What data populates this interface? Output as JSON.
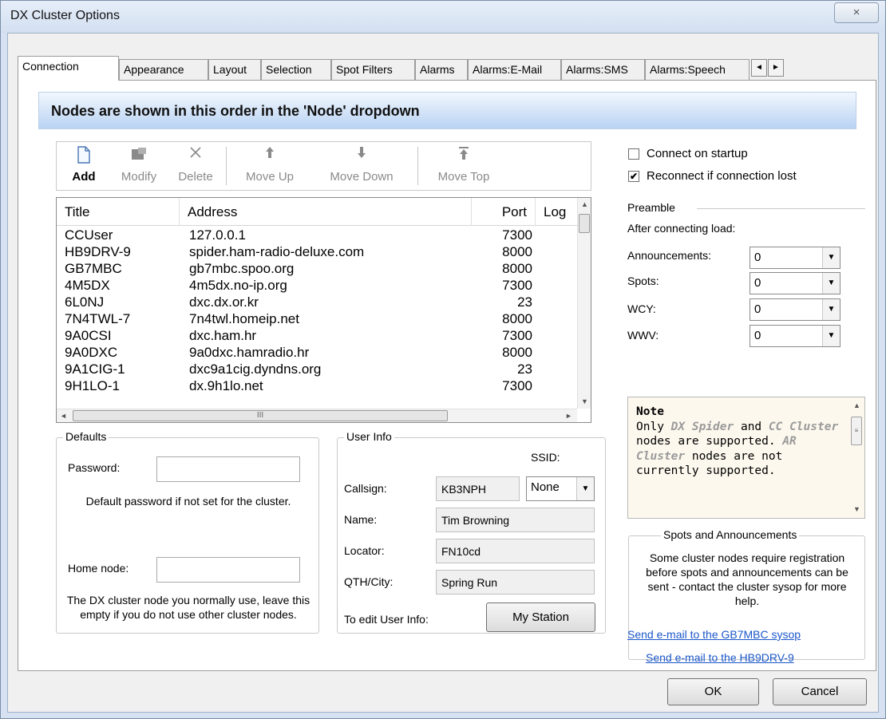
{
  "window": {
    "title": "DX Cluster Options",
    "close_icon": "×"
  },
  "tabs": [
    "Connection",
    "Appearance",
    "Layout",
    "Selection",
    "Spot Filters",
    "Alarms",
    "Alarms:E-Mail",
    "Alarms:SMS",
    "Alarms:Speech"
  ],
  "banner": "Nodes are shown in this order in the 'Node' dropdown",
  "toolbar": {
    "add": "Add",
    "modify": "Modify",
    "delete": "Delete",
    "move_up": "Move Up",
    "move_down": "Move Down",
    "move_top": "Move Top"
  },
  "list": {
    "columns": {
      "title": "Title",
      "address": "Address",
      "port": "Port",
      "log": "Log"
    },
    "rows": [
      {
        "title": "CCUser",
        "address": "127.0.0.1",
        "port": "7300"
      },
      {
        "title": "HB9DRV-9",
        "address": "spider.ham-radio-deluxe.com",
        "port": "8000"
      },
      {
        "title": "GB7MBC",
        "address": "gb7mbc.spoo.org",
        "port": "8000"
      },
      {
        "title": "4M5DX",
        "address": "4m5dx.no-ip.org",
        "port": "7300"
      },
      {
        "title": "6L0NJ",
        "address": "dxc.dx.or.kr",
        "port": "23"
      },
      {
        "title": "7N4TWL-7",
        "address": "7n4twl.homeip.net",
        "port": "8000"
      },
      {
        "title": "9A0CSI",
        "address": "dxc.ham.hr",
        "port": "7300"
      },
      {
        "title": "9A0DXC",
        "address": "9a0dxc.hamradio.hr",
        "port": "8000"
      },
      {
        "title": "9A1CIG-1",
        "address": "dxc9a1cig.dyndns.org",
        "port": "23"
      },
      {
        "title": "9H1LO-1",
        "address": "dx.9h1lo.net",
        "port": "7300"
      }
    ]
  },
  "options": {
    "connect_on_startup": {
      "label": "Connect on startup",
      "checked": false
    },
    "reconnect": {
      "label": "Reconnect if connection lost",
      "checked": true
    }
  },
  "preamble": {
    "title": "Preamble",
    "intro": "After connecting load:",
    "announcements_label": "Announcements:",
    "announcements_value": "0",
    "spots_label": "Spots:",
    "spots_value": "0",
    "wcy_label": "WCY:",
    "wcy_value": "0",
    "wwv_label": "WWV:",
    "wwv_value": "0"
  },
  "note": {
    "heading": "Note",
    "t1": "Only ",
    "h1": "DX Spider",
    "t2": " and ",
    "h2": "CC Cluster",
    "t3": " nodes are supported. ",
    "h3": "AR Cluster",
    "t4": " nodes are not currently supported."
  },
  "spots_group": {
    "title": "Spots and Announcements",
    "text": "Some cluster nodes require registration before spots and announcements can be sent - contact the cluster sysop for more help.",
    "link1": "Send e-mail to the GB7MBC sysop",
    "link2": "Send e-mail to the HB9DRV-9"
  },
  "defaults": {
    "title": "Defaults",
    "password_label": "Password:",
    "password_value": "",
    "password_help": "Default password if not set for the cluster.",
    "home_label": "Home node:",
    "home_value": "",
    "home_help": "The DX cluster node you normally use, leave this empty if you do not use other cluster nodes."
  },
  "user_info": {
    "title": "User Info",
    "ssid_label": "SSID:",
    "callsign_label": "Callsign:",
    "callsign": "KB3NPH",
    "ssid_value": "None",
    "name_label": "Name:",
    "name": "Tim Browning",
    "locator_label": "Locator:",
    "locator": "FN10cd",
    "qth_label": "QTH/City:",
    "qth": "Spring Run",
    "edit_label": "To edit User Info:",
    "my_station": "My Station"
  },
  "buttons": {
    "ok": "OK",
    "cancel": "Cancel"
  },
  "scroll_glyphs": {
    "up": "▲",
    "down": "▼",
    "left": "◄",
    "right": "►",
    "grip": "III"
  }
}
